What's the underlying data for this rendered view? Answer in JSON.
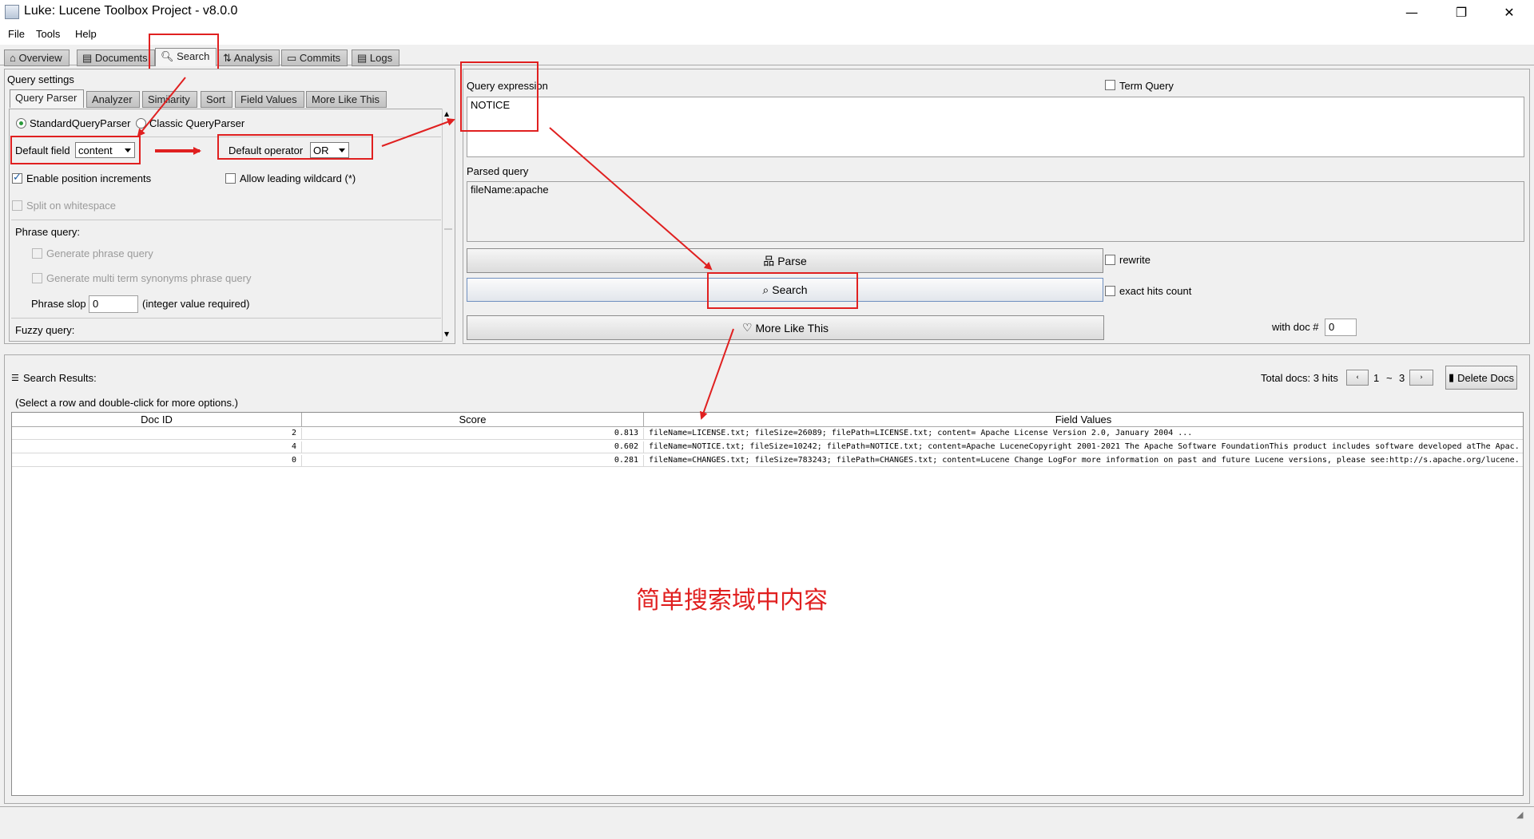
{
  "window": {
    "title": "Luke: Lucene Toolbox Project - v8.0.0",
    "minimize": "—",
    "restore": "❐",
    "close": "✕"
  },
  "menu": [
    "File",
    "Tools",
    "Help"
  ],
  "main_tabs": [
    {
      "label": "Overview",
      "icon": "home-icon"
    },
    {
      "label": "Documents",
      "icon": "documents-icon"
    },
    {
      "label": "Search",
      "icon": "search-doc-icon",
      "active": true
    },
    {
      "label": "Analysis",
      "icon": "analysis-icon"
    },
    {
      "label": "Commits",
      "icon": "commits-icon"
    },
    {
      "label": "Logs",
      "icon": "logs-icon"
    }
  ],
  "query_settings": {
    "heading": "Query settings",
    "tabs": [
      "Query Parser",
      "Analyzer",
      "Similarity",
      "Sort",
      "Field Values",
      "More Like This"
    ],
    "standard_parser": "StandardQueryParser",
    "classic_parser": "Classic QueryParser",
    "default_field_label": "Default field",
    "default_field_value": "content",
    "default_operator_label": "Default operator",
    "default_operator_value": "OR",
    "enable_position_increments": "Enable position increments",
    "allow_leading_wildcard": "Allow leading wildcard (*)",
    "split_on_whitespace": "Split on whitespace",
    "phrase_query_heading": "Phrase query:",
    "generate_phrase_query": "Generate phrase query",
    "generate_multi_term": "Generate multi term synonyms phrase query",
    "phrase_slop_label": "Phrase slop",
    "phrase_slop_value": "0",
    "phrase_slop_hint": "(integer value required)",
    "fuzzy_query_heading": "Fuzzy query:"
  },
  "query": {
    "expression_label": "Query expression",
    "expression_value": "NOTICE",
    "term_query_label": "Term Query",
    "parsed_label": "Parsed query",
    "parsed_value": "fileName:apache",
    "parse_button": "Parse",
    "rewrite_label": "rewrite",
    "search_button": "Search",
    "exact_hits_label": "exact hits count",
    "mlt_button": "More Like This",
    "with_doc_label": "with doc #",
    "with_doc_value": "0"
  },
  "results": {
    "heading": "Search Results:",
    "hint": "(Select a row and double-click for more options.)",
    "total_docs_label": "Total docs: 3 hits",
    "page_current": "1",
    "page_sep": "~",
    "page_total": "3",
    "prev_label": "‹",
    "next_label": "›",
    "delete_docs": "Delete Docs",
    "columns": [
      "Doc ID",
      "Score",
      "Field Values"
    ],
    "rows": [
      {
        "doc_id": "2",
        "score": "0.813",
        "fields": "fileName=LICENSE.txt; fileSize=26089; filePath=LICENSE.txt; content=                                                   Apache License                           Version 2.0, January 2004                    ..."
      },
      {
        "doc_id": "4",
        "score": "0.602",
        "fields": "fileName=NOTICE.txt; fileSize=10242; filePath=NOTICE.txt; content=Apache LuceneCopyright 2001-2021 The Apache Software FoundationThis product includes software developed atThe Apac..."
      },
      {
        "doc_id": "0",
        "score": "0.281",
        "fields": "fileName=CHANGES.txt; fileSize=783243; filePath=CHANGES.txt; content=Lucene Change LogFor more information on past and future Lucene versions, please see:http://s.apache.org/lucene..."
      }
    ]
  },
  "annotation_note": "简单搜索域中内容",
  "colors": {
    "annotation_red": "#e02020",
    "accent_green": "#2a9a3a"
  }
}
